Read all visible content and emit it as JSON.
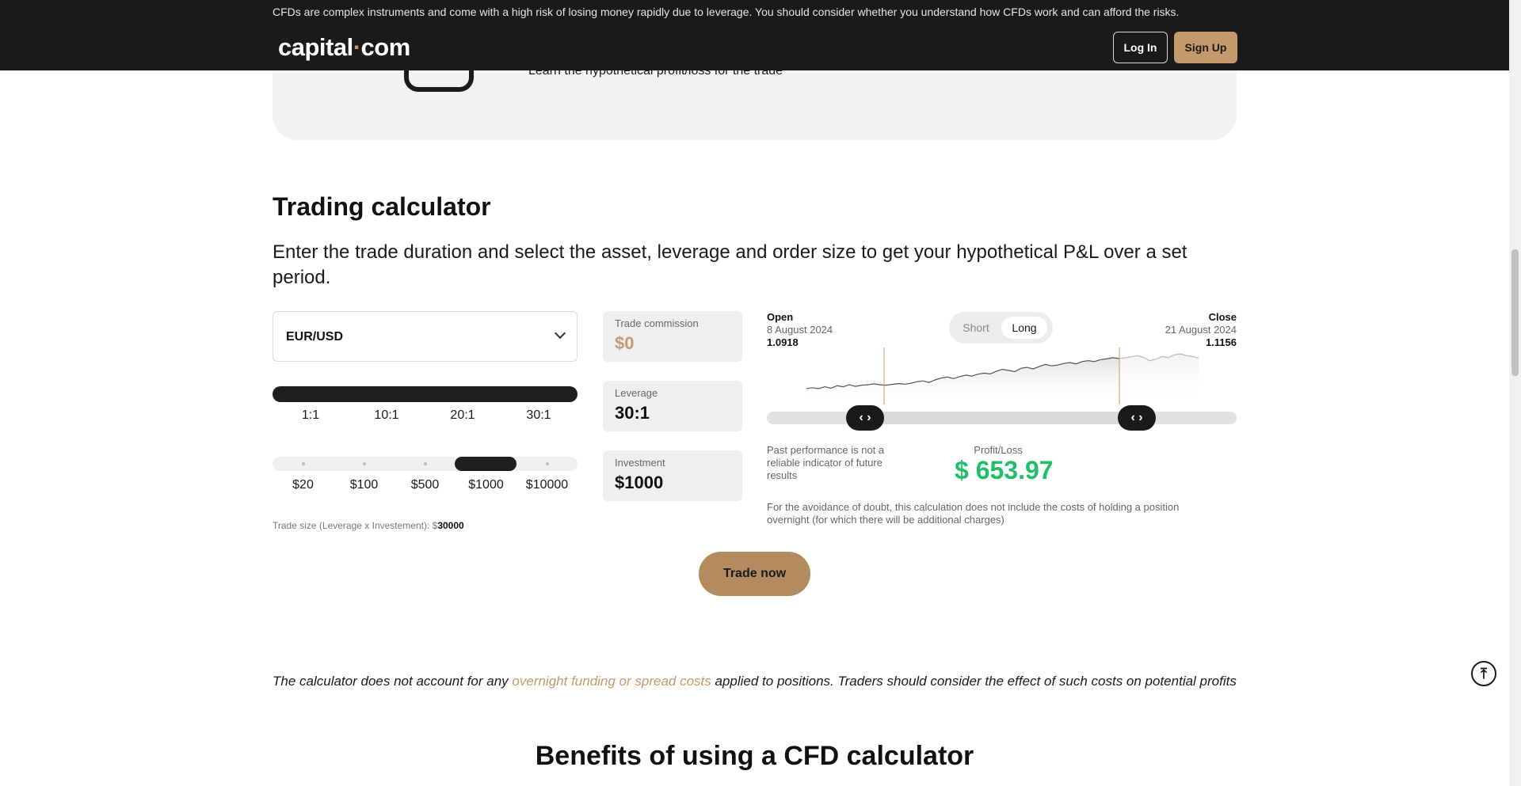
{
  "header": {
    "risk_warning": "CFDs are complex instruments and come with a high risk of losing money rapidly due to leverage. You should consider whether you understand how CFDs work and can afford the risks.",
    "logo_left": "capital",
    "logo_dot": "·",
    "logo_right": "com",
    "login_label": "Log In",
    "signup_label": "Sign Up"
  },
  "step_card": {
    "text": "Learn the hypothetical profit/loss for the trade"
  },
  "section": {
    "title": "Trading calculator",
    "lead": "Enter the trade duration and select the asset, leverage and order size to get your hypothetical P&L over a set period."
  },
  "calculator": {
    "asset": "EUR/USD",
    "leverage_options": [
      "1:1",
      "10:1",
      "20:1",
      "30:1"
    ],
    "selected_leverage": "30:1",
    "investment_options": [
      "$20",
      "$100",
      "$500",
      "$1000",
      "$10000"
    ],
    "selected_investment": "$1000",
    "trade_size_label": "Trade size (Leverage x Investement): $",
    "trade_size_value": "30000",
    "commission_label": "Trade commission",
    "commission_value": "$0",
    "leverage_label": "Leverage",
    "leverage_value": "30:1",
    "investment_label": "Investment",
    "investment_value": "$1000"
  },
  "chart_panel": {
    "open_label": "Open",
    "open_date": "8 August 2024",
    "open_price": "1.0918",
    "close_label": "Close",
    "close_date": "21 August 2024",
    "close_price": "1.1156",
    "toggle_short": "Short",
    "toggle_long": "Long",
    "selected_direction": "Long",
    "handle_left": "‹ ›",
    "handle_right": "‹ ›",
    "past_performance": "Past performance is not a reliable indicator of future results",
    "pl_label": "Profit/Loss",
    "pl_value": "$ 653.97",
    "overnight_note": "For the avoidance of doubt, this calculation does not include the costs of holding a position overnight (for which there will be additional charges)",
    "series": [
      3,
      3.5,
      3,
      4,
      3.2,
      4.5,
      4,
      5,
      4.2,
      4.8,
      5,
      5.5,
      5,
      4.8,
      5.2,
      5.6,
      5.3,
      5.8,
      6.5,
      7,
      6.2,
      7.5,
      8.5,
      9,
      8.2,
      9.2,
      10,
      9.5,
      10.5,
      11,
      10.6,
      12,
      13,
      12.4,
      11.8,
      13.5,
      14,
      13.2,
      14.5,
      15.5,
      14.8,
      15.2,
      16,
      16.5,
      15.8,
      17,
      17.5,
      17,
      18,
      18.4,
      19,
      18.6,
      18.9,
      19.5,
      20,
      19.2,
      17.5,
      18.2,
      19.6,
      19,
      20.4,
      21,
      20.1,
      19.6,
      18.8
    ]
  },
  "trade_now_label": "Trade now",
  "footnote": {
    "before": "The calculator does not account for any ",
    "link": "overnight funding or spread costs",
    "after": " applied to positions. Traders should consider the effect of such costs on potential profits"
  },
  "next_section_title": "Benefits of using a CFD calculator",
  "back_to_top_icon": "⤒",
  "colors": {
    "accent": "#c49a6c",
    "profit": "#1fbf6a",
    "dark": "#1a1a1a"
  }
}
